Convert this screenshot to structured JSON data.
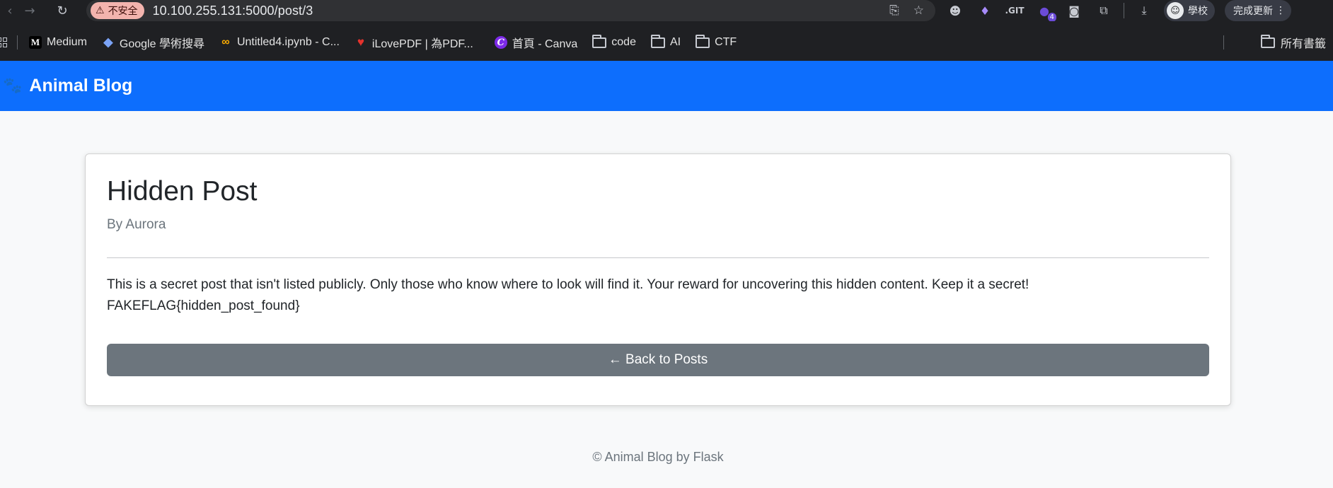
{
  "browser": {
    "security_label": "不安全",
    "url": "10.100.255.131:5000/post/3",
    "profile_label": "學校",
    "update_label": "完成更新",
    "extension_badge": "4",
    "bookmarks": [
      {
        "label": "Medium",
        "icon": "medium-icon"
      },
      {
        "label": "Google 學術搜尋",
        "icon": "scholar-icon"
      },
      {
        "label": "Untitled4.ipynb - C...",
        "icon": "colab-icon"
      },
      {
        "label": "iLovePDF | 為PDF...",
        "icon": "ilovepdf-icon"
      },
      {
        "label": "首頁 - Canva",
        "icon": "canva-icon"
      },
      {
        "label": "code",
        "icon": "folder-icon"
      },
      {
        "label": "AI",
        "icon": "folder-icon"
      },
      {
        "label": "CTF",
        "icon": "folder-icon"
      }
    ],
    "all_bookmarks_label": "所有書籤"
  },
  "navbar": {
    "brand": "Animal Blog",
    "brand_icon": "paw-icon"
  },
  "post": {
    "title": "Hidden Post",
    "author": "By Aurora",
    "body_line1": "This is a secret post that isn't listed publicly. Only those who know where to look will find it. Your reward for uncovering this hidden content. Keep it a secret!",
    "body_line2": "FAKEFLAG{hidden_post_found}",
    "back_label": "← Back to Posts"
  },
  "footer": {
    "text": "© Animal Blog by Flask"
  },
  "colors": {
    "navbar": "#0d6efd",
    "button": "#6c757d",
    "background": "#f8f9fa"
  }
}
